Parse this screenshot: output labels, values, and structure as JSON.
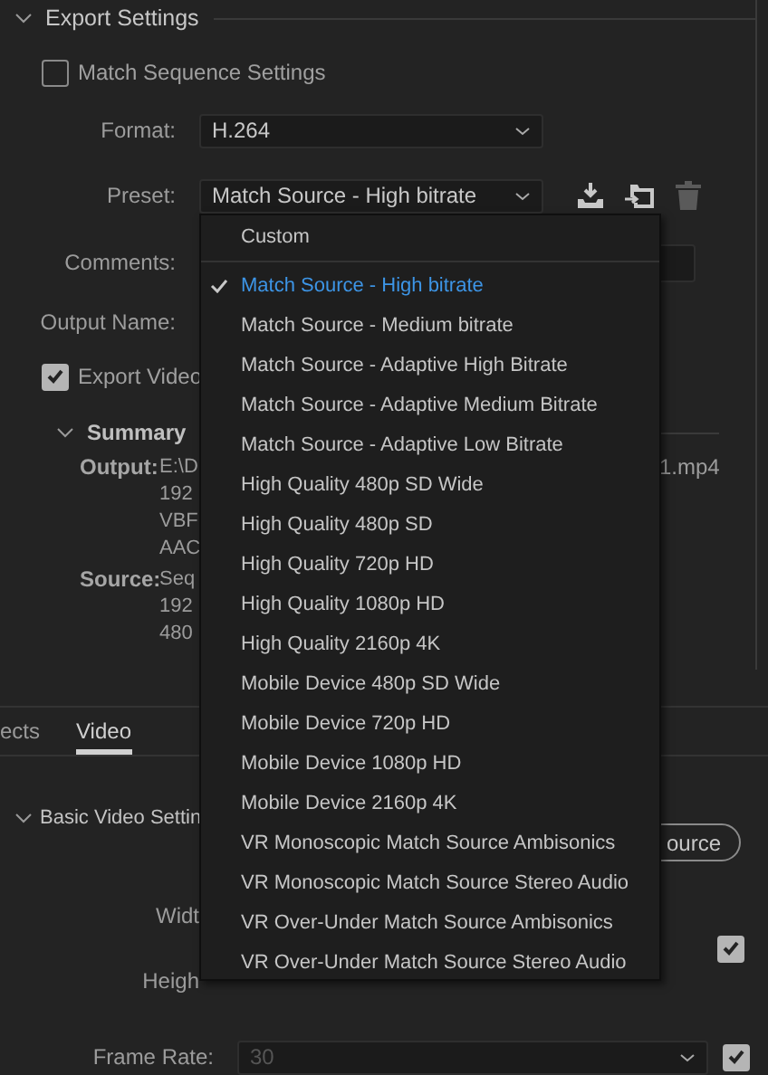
{
  "section": {
    "title": "Export Settings",
    "expanded": true
  },
  "match_sequence": {
    "label": "Match Sequence Settings",
    "checked": false
  },
  "format": {
    "label": "Format:",
    "value": "H.264"
  },
  "preset": {
    "label": "Preset:",
    "value": "Match Source - High bitrate"
  },
  "comments": {
    "label": "Comments:"
  },
  "output_name": {
    "label": "Output Name:"
  },
  "export_video": {
    "label": "Export Video",
    "checked": true
  },
  "summary": {
    "title": "Summary",
    "expanded": true,
    "output_tail": "1.mp4",
    "rows": [
      {
        "label": "Output:",
        "lines": [
          "E:\\D",
          "192",
          "VBF",
          "AAC"
        ]
      },
      {
        "label": "Source:",
        "lines": [
          "Seq",
          "192",
          "480"
        ]
      }
    ]
  },
  "tabs": [
    {
      "label": "ects",
      "selected": false
    },
    {
      "label": "Video",
      "selected": true
    }
  ],
  "video_section": {
    "title": "Basic Video Settin",
    "expanded": true,
    "button": "ource"
  },
  "width": {
    "label": "Widt"
  },
  "link": {
    "checked": true
  },
  "height": {
    "label": "Heigh"
  },
  "frame_rate": {
    "label": "Frame Rate:",
    "value": "30",
    "disabled": true,
    "checked": true
  },
  "preset_menu": {
    "items": [
      {
        "kind": "option",
        "label": "Custom",
        "selected": false
      },
      {
        "kind": "separator"
      },
      {
        "kind": "option",
        "label": "Match Source - High bitrate",
        "selected": true
      },
      {
        "kind": "option",
        "label": "Match Source - Medium bitrate",
        "selected": false
      },
      {
        "kind": "option",
        "label": "Match Source - Adaptive High Bitrate",
        "selected": false
      },
      {
        "kind": "option",
        "label": "Match Source - Adaptive Medium Bitrate",
        "selected": false
      },
      {
        "kind": "option",
        "label": "Match Source - Adaptive Low Bitrate",
        "selected": false
      },
      {
        "kind": "option",
        "label": "High Quality 480p SD Wide",
        "selected": false
      },
      {
        "kind": "option",
        "label": "High Quality 480p SD",
        "selected": false
      },
      {
        "kind": "option",
        "label": "High Quality 720p HD",
        "selected": false
      },
      {
        "kind": "option",
        "label": "High Quality 1080p HD",
        "selected": false
      },
      {
        "kind": "option",
        "label": "High Quality 2160p 4K",
        "selected": false
      },
      {
        "kind": "option",
        "label": "Mobile Device 480p SD Wide",
        "selected": false
      },
      {
        "kind": "option",
        "label": "Mobile Device 720p HD",
        "selected": false
      },
      {
        "kind": "option",
        "label": "Mobile Device 1080p HD",
        "selected": false
      },
      {
        "kind": "option",
        "label": "Mobile Device 2160p 4K",
        "selected": false
      },
      {
        "kind": "option",
        "label": "VR Monoscopic Match Source Ambisonics",
        "selected": false
      },
      {
        "kind": "option",
        "label": "VR Monoscopic Match Source Stereo Audio",
        "selected": false
      },
      {
        "kind": "option",
        "label": "VR Over-Under Match Source Ambisonics",
        "selected": false
      },
      {
        "kind": "option",
        "label": "VR Over-Under Match Source Stereo Audio",
        "selected": false
      }
    ]
  }
}
